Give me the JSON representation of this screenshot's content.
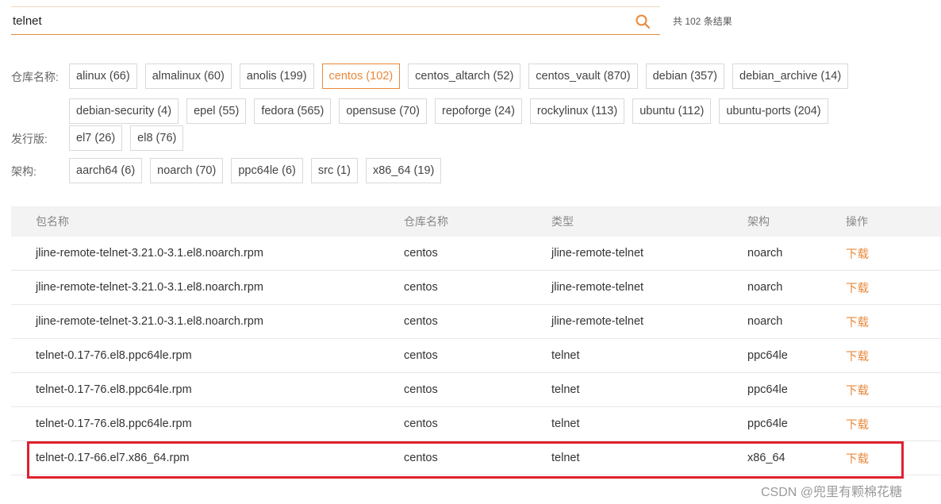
{
  "search": {
    "value": "telnet",
    "placeholder": ""
  },
  "result_count": "共 102 条结果",
  "filters": {
    "repo": {
      "label": "仓库名称:",
      "chips": [
        "alinux (66)",
        "almalinux (60)",
        "anolis (199)",
        "centos (102)",
        "centos_altarch (52)",
        "centos_vault (870)",
        "debian (357)",
        "debian_archive (14)",
        "debian-security (4)",
        "epel (55)",
        "fedora (565)",
        "opensuse (70)",
        "repoforge (24)",
        "rockylinux (113)",
        "ubuntu (112)",
        "ubuntu-ports (204)"
      ],
      "active_index": 3
    },
    "release": {
      "label": "发行版:",
      "chips": [
        "el7 (26)",
        "el8 (76)"
      ]
    },
    "arch": {
      "label": "架构:",
      "chips": [
        "aarch64 (6)",
        "noarch (70)",
        "ppc64le (6)",
        "src (1)",
        "x86_64 (19)"
      ]
    }
  },
  "table": {
    "headers": {
      "name": "包名称",
      "repo": "仓库名称",
      "type": "类型",
      "arch": "架构",
      "op": "操作"
    },
    "rows": [
      {
        "name": "jline-remote-telnet-3.21.0-3.1.el8.noarch.rpm",
        "repo": "centos",
        "type": "jline-remote-telnet",
        "arch": "noarch",
        "op": "下载"
      },
      {
        "name": "jline-remote-telnet-3.21.0-3.1.el8.noarch.rpm",
        "repo": "centos",
        "type": "jline-remote-telnet",
        "arch": "noarch",
        "op": "下载"
      },
      {
        "name": "jline-remote-telnet-3.21.0-3.1.el8.noarch.rpm",
        "repo": "centos",
        "type": "jline-remote-telnet",
        "arch": "noarch",
        "op": "下载"
      },
      {
        "name": "telnet-0.17-76.el8.ppc64le.rpm",
        "repo": "centos",
        "type": "telnet",
        "arch": "ppc64le",
        "op": "下载"
      },
      {
        "name": "telnet-0.17-76.el8.ppc64le.rpm",
        "repo": "centos",
        "type": "telnet",
        "arch": "ppc64le",
        "op": "下载"
      },
      {
        "name": "telnet-0.17-76.el8.ppc64le.rpm",
        "repo": "centos",
        "type": "telnet",
        "arch": "ppc64le",
        "op": "下载"
      },
      {
        "name": "telnet-0.17-66.el7.x86_64.rpm",
        "repo": "centos",
        "type": "telnet",
        "arch": "x86_64",
        "op": "下载"
      }
    ]
  },
  "watermark": "CSDN @兜里有颗棉花糖",
  "colors": {
    "accent": "#e8883b",
    "highlight": "#e0202f"
  },
  "icons": {
    "search": "search-icon"
  }
}
